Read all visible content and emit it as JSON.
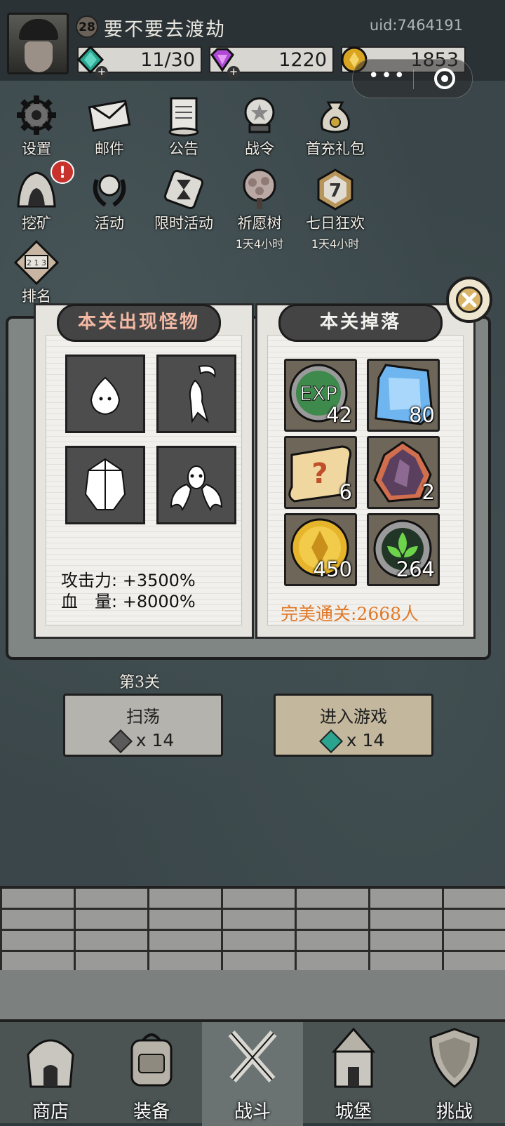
{
  "player": {
    "level": "28",
    "name": "要不要去渡劫",
    "uid": "uid:7464191"
  },
  "resources": {
    "energy": "11/30",
    "gems": "1220",
    "coins": "1853"
  },
  "menu": {
    "row1": [
      "设置",
      "邮件",
      "公告",
      "战令",
      "首充礼包"
    ],
    "row2": [
      "挖矿",
      "活动",
      "限时活动",
      "祈愿树",
      "七日狂欢"
    ],
    "row2_sub": {
      "wish_tree": "1天4小时",
      "seven_day": "1天4小时"
    },
    "seven_day_number": "7",
    "ranking": "排名",
    "ranking_digits": "2 1 3"
  },
  "stage_panel": {
    "monsters_title": "本关出现怪物",
    "drops_title": "本关掉落",
    "attack_label": "攻击力:",
    "attack_value": "+3500%",
    "hp_label": "血　量:",
    "hp_value": "+8000%",
    "drops": [
      {
        "item": "exp-orb",
        "qty": "42",
        "label": "EXP"
      },
      {
        "item": "blue-gem",
        "qty": "80"
      },
      {
        "item": "mystery-scroll",
        "qty": "6"
      },
      {
        "item": "dark-crystal",
        "qty": "2"
      },
      {
        "item": "gold-coin",
        "qty": "450"
      },
      {
        "item": "green-rune",
        "qty": "264"
      }
    ],
    "perfect_clear": "完美通关:2668人"
  },
  "stage": {
    "label": "第3关",
    "sweep_label": "扫荡",
    "sweep_cost": "x 14",
    "enter_label": "进入游戏",
    "enter_cost": "x 14"
  },
  "nav": [
    "商店",
    "装备",
    "战斗",
    "城堡",
    "挑战"
  ],
  "colors": {
    "accent_orange": "#e07a2a",
    "alert_red": "#c8322d",
    "energy_teal": "#2aa38f",
    "gem_purple": "#b04ad6",
    "coin_gold": "#d9a520"
  }
}
